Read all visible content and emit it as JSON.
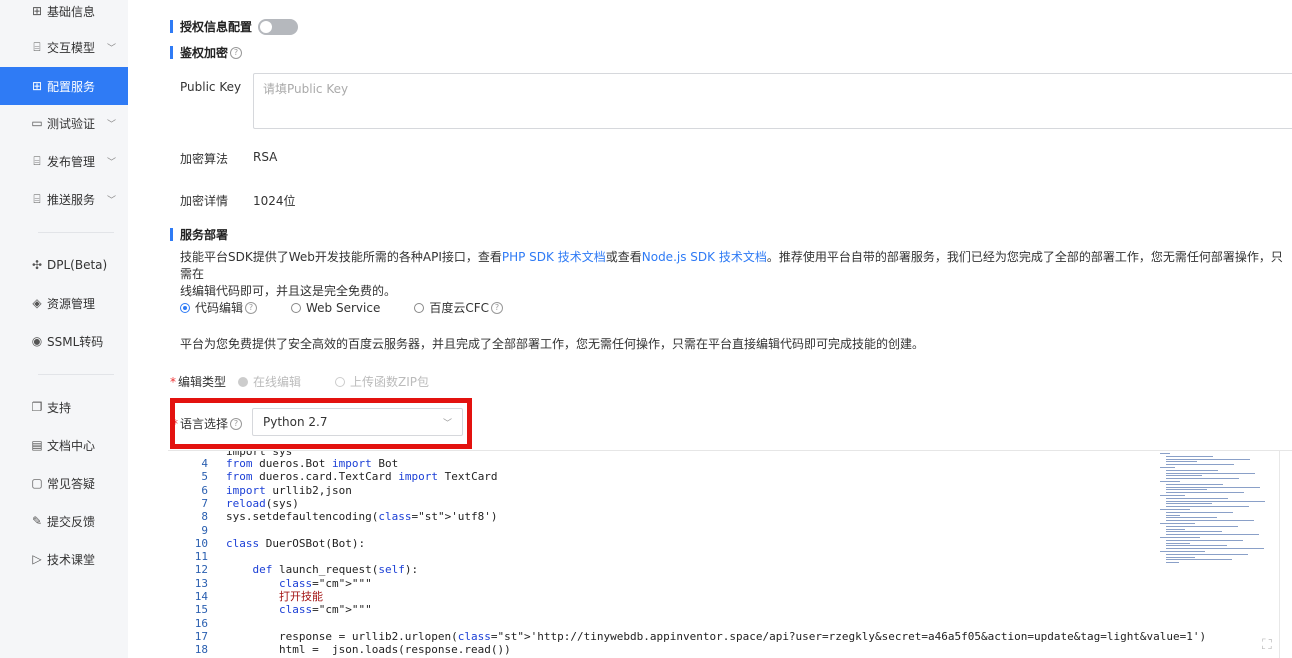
{
  "sidebar": {
    "items": [
      {
        "label": "基础信息",
        "icon": "grid-icon",
        "chevron": false,
        "active": false
      },
      {
        "label": "交互模型",
        "icon": "doc-cursor-icon",
        "chevron": true,
        "active": false
      },
      {
        "label": "配置服务",
        "icon": "grid-icon",
        "chevron": false,
        "active": true
      },
      {
        "label": "测试验证",
        "icon": "monitor-icon",
        "chevron": true,
        "active": false
      },
      {
        "label": "发布管理",
        "icon": "doc-cursor-icon",
        "chevron": true,
        "active": false
      },
      {
        "label": "推送服务",
        "icon": "doc-cursor-icon",
        "chevron": true,
        "active": false
      },
      {
        "label": "DPL(Beta)",
        "icon": "puzzle-icon",
        "chevron": false,
        "active": false
      },
      {
        "label": "资源管理",
        "icon": "layers-icon",
        "chevron": false,
        "active": false
      },
      {
        "label": "SSML转码",
        "icon": "target-icon",
        "chevron": false,
        "active": false
      },
      {
        "label": "支持",
        "icon": "copy-icon",
        "chevron": false,
        "active": false
      },
      {
        "label": "文档中心",
        "icon": "file-icon",
        "chevron": false,
        "active": false
      },
      {
        "label": "常见答疑",
        "icon": "chat-icon",
        "chevron": false,
        "active": false
      },
      {
        "label": "提交反馈",
        "icon": "edit-icon",
        "chevron": false,
        "active": false
      },
      {
        "label": "技术课堂",
        "icon": "play-icon",
        "chevron": false,
        "active": false
      }
    ]
  },
  "auth_config": {
    "title": "授权信息配置",
    "enabled": false
  },
  "auth_encrypt": {
    "title": "鉴权加密",
    "public_key_label": "Public Key",
    "public_key_placeholder": "请填Public Key",
    "algo_label": "加密算法",
    "algo_value": "RSA",
    "detail_label": "加密详情",
    "detail_value": "1024位"
  },
  "deploy": {
    "title": "服务部署",
    "desc_part1": "技能平台SDK提供了Web开发技能所需的各种API接口，查看",
    "link_php": "PHP SDK 技术文档",
    "desc_part2": "或查看",
    "link_node": "Node.js SDK 技术文档",
    "desc_part3": "。推荐使用平台自带的部署服务，我们已经为您完成了全部的部署工作，您无需任何部署操作，只需在",
    "desc_line2": "线编辑代码即可，并且这是完全免费的。",
    "options": [
      "代码编辑",
      "Web Service",
      "百度云CFC"
    ],
    "selected": "代码编辑",
    "platform_desc": "平台为您免费提供了安全高效的百度云服务器，并且完成了全部部署工作，您无需任何操作，只需在平台直接编辑代码即可完成技能的创建。",
    "edit_type_label": "编辑类型",
    "edit_type_options": [
      "在线编辑",
      "上传函数ZIP包"
    ],
    "lang_label": "语言选择",
    "lang_value": "Python 2.7"
  },
  "code": {
    "lines": [
      {
        "n": "4",
        "t": "from dueros.Bot import Bot"
      },
      {
        "n": "5",
        "t": "from dueros.card.TextCard import TextCard"
      },
      {
        "n": "6",
        "t": "import urllib2,json"
      },
      {
        "n": "7",
        "t": "reload(sys)"
      },
      {
        "n": "8",
        "t": "sys.setdefaultencoding('utf8')"
      },
      {
        "n": "9",
        "t": ""
      },
      {
        "n": "10",
        "t": "class DuerOSBot(Bot):"
      },
      {
        "n": "11",
        "t": ""
      },
      {
        "n": "12",
        "t": "    def launch_request(self):"
      },
      {
        "n": "13",
        "t": "        \"\"\""
      },
      {
        "n": "14",
        "t": "        打开技能"
      },
      {
        "n": "15",
        "t": "        \"\"\""
      },
      {
        "n": "16",
        "t": ""
      },
      {
        "n": "17",
        "t": "        response = urllib2.urlopen('http://tinywebdb.appinventor.space/api?user=rzegkly&secret=a46a5f05&action=update&tag=light&value=1')"
      },
      {
        "n": "18",
        "t": "        html =  json.loads(response.read())"
      }
    ],
    "partial_top": "import sys"
  }
}
